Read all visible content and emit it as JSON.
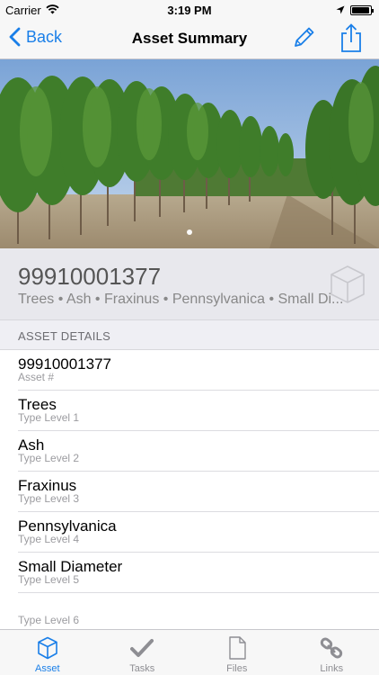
{
  "status_bar": {
    "carrier": "Carrier",
    "time": "3:19 PM",
    "battery_level": 0.95
  },
  "nav": {
    "back_label": "Back",
    "title": "Asset Summary",
    "edit_icon": "pencil-icon",
    "share_icon": "share-icon"
  },
  "hero": {
    "page_count": 1,
    "current_page": 1
  },
  "summary": {
    "asset_id": "99910001377",
    "type_path": "Trees • Ash • Fraxinus • Pennsylvanica • Small Di..."
  },
  "section": {
    "header": "ASSET DETAILS"
  },
  "details": [
    {
      "value": "99910001377",
      "label": "Asset #"
    },
    {
      "value": "Trees",
      "label": "Type Level 1"
    },
    {
      "value": "Ash",
      "label": "Type Level 2"
    },
    {
      "value": "Fraxinus",
      "label": "Type Level 3"
    },
    {
      "value": "Pennsylvanica",
      "label": "Type Level 4"
    },
    {
      "value": "Small Diameter",
      "label": "Type Level 5"
    },
    {
      "value": "",
      "label": "Type Level 6"
    }
  ],
  "tabs": [
    {
      "label": "Asset",
      "icon": "cube-icon",
      "active": true
    },
    {
      "label": "Tasks",
      "icon": "checkmark-icon",
      "active": false
    },
    {
      "label": "Files",
      "icon": "file-icon",
      "active": false
    },
    {
      "label": "Links",
      "icon": "link-icon",
      "active": false
    }
  ],
  "colors": {
    "accent": "#1a7fe8",
    "inactive_tab": "#8e8e93"
  }
}
